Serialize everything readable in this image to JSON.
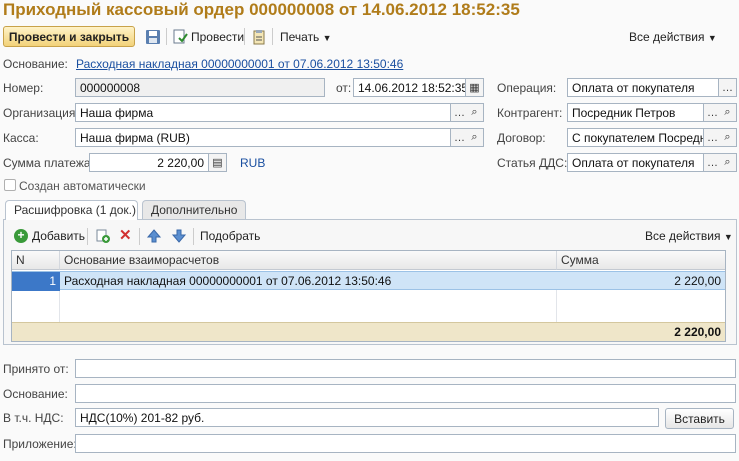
{
  "window": {
    "title": "Приходный кассовый ордер 000000008 от 14.06.2012 18:52:35"
  },
  "toolbar": {
    "post_close_label": "Провести и закрыть",
    "post_label": "Провести",
    "print_label": "Печать",
    "all_actions_label": "Все действия"
  },
  "basis": {
    "label": "Основание:",
    "link": "Расходная накладная 00000000001 от 07.06.2012 13:50:46"
  },
  "number": {
    "label": "Номер:",
    "value": "000000008"
  },
  "date": {
    "label": "от:",
    "value": "14.06.2012 18:52:35"
  },
  "operation": {
    "label": "Операция:",
    "value": "Оплата от покупателя"
  },
  "organization": {
    "label": "Организация:",
    "value": "Наша фирма"
  },
  "counterparty": {
    "label": "Контрагент:",
    "value": "Посредник Петров"
  },
  "cashbox": {
    "label": "Касса:",
    "value": "Наша фирма (RUB)"
  },
  "contract": {
    "label": "Договор:",
    "value": "С покупателем Посредни"
  },
  "amount": {
    "label": "Сумма платежа:",
    "value": "2 220,00",
    "currency": "RUB"
  },
  "cashflow": {
    "label": "Статья ДДС:",
    "value": "Оплата от покупателя"
  },
  "auto_created": {
    "label": "Создан автоматически",
    "checked": false
  },
  "tabs": [
    {
      "label": "Расшифровка (1 док.)",
      "active": true
    },
    {
      "label": "Дополнительно",
      "active": false
    }
  ],
  "tab_toolbar": {
    "add_label": "Добавить",
    "pick_label": "Подобрать",
    "all_actions_label": "Все действия"
  },
  "table": {
    "columns": [
      "N",
      "Основание взаиморасчетов",
      "Сумма"
    ],
    "rows": [
      {
        "n": "1",
        "basis": "Расходная накладная 00000000001 от 07.06.2012 13:50:46",
        "sum": "2 220,00"
      }
    ],
    "total": "2 220,00"
  },
  "received_from": {
    "label": "Принято от:",
    "value": ""
  },
  "basis2": {
    "label": "Основание:",
    "value": ""
  },
  "vat": {
    "label": "В т.ч. НДС:",
    "value": "НДС(10%) 201-82 руб.",
    "insert_label": "Вставить"
  },
  "attachment": {
    "label": "Приложение:",
    "value": ""
  },
  "colors": {
    "title": "#b07c1a",
    "link": "#1a4fa0",
    "selected_row": "#cfe4f7",
    "total_row": "#efe6c9"
  }
}
